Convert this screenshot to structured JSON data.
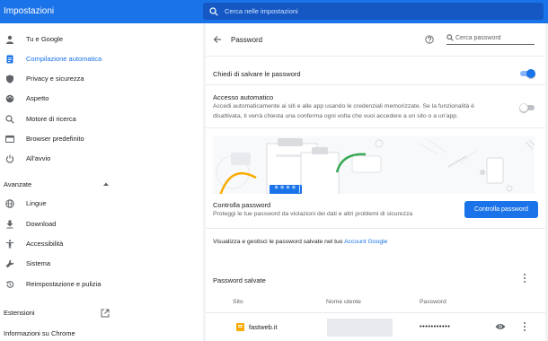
{
  "app": {
    "title": "Impostazioni"
  },
  "search": {
    "placeholder": "Cerca nelle impostazioni"
  },
  "sidebar": {
    "items": [
      {
        "label": "Tu e Google",
        "icon": "person-icon"
      },
      {
        "label": "Compilazione automatica",
        "icon": "autofill-icon",
        "active": true
      },
      {
        "label": "Privacy e sicurezza",
        "icon": "shield-icon"
      },
      {
        "label": "Aspetto",
        "icon": "palette-icon"
      },
      {
        "label": "Motore di ricerca",
        "icon": "search-icon"
      },
      {
        "label": "Browser predefinito",
        "icon": "browser-icon"
      },
      {
        "label": "All'avvio",
        "icon": "power-icon"
      }
    ],
    "advanced_label": "Avanzate",
    "advanced_items": [
      {
        "label": "Lingue",
        "icon": "globe-icon"
      },
      {
        "label": "Download",
        "icon": "download-icon"
      },
      {
        "label": "Accessibilità",
        "icon": "accessibility-icon"
      },
      {
        "label": "Sistema",
        "icon": "wrench-icon"
      },
      {
        "label": "Reimpostazione e pulizia",
        "icon": "restore-icon"
      }
    ],
    "extensions_label": "Estensioni",
    "about_label": "Informazioni su Chrome"
  },
  "password": {
    "title": "Password",
    "search_placeholder": "Cerca password",
    "offer_save": {
      "label": "Chiedi di salvare le password",
      "enabled": true
    },
    "auto_signin": {
      "title": "Accesso automatico",
      "desc_line1": "Accedi automaticamente ai siti e alle app usando le credenziali memorizzate. Se la funzionalità è",
      "desc_line2": "disattivata, ti verrà chiesta una conferma ogni volta che vuoi accedere a un sito o a un'app.",
      "enabled": false
    },
    "illustration_mask": "****|",
    "check": {
      "title": "Controlla password",
      "desc": "Proteggi le tue password da violazioni dei dati e altri problemi di sicurezza",
      "button": "Controlla password"
    },
    "manage_text": "Visualizza e gestisci le password salvate nel tuo",
    "manage_link": "Account Google",
    "saved": {
      "title": "Password salvate",
      "columns": [
        "Sito",
        "Nome utente",
        "Password"
      ],
      "rows": [
        {
          "site": "fastweb.it",
          "username": "",
          "password": "•••••••••••"
        }
      ]
    }
  },
  "colors": {
    "accent": "#1a73e8",
    "topbar": "#1a73e8",
    "text": "#202124",
    "muted": "#5f6368"
  }
}
